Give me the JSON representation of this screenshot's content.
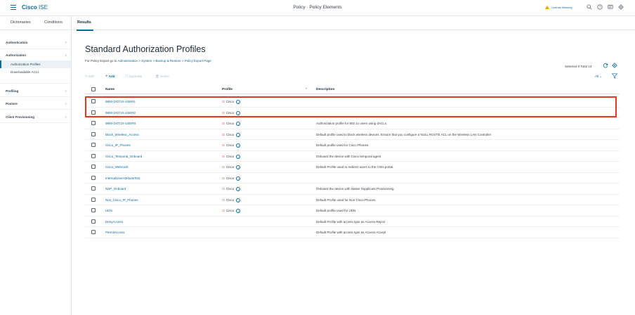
{
  "header": {
    "brand_cisco": "Cisco",
    "brand_ise": "ISE",
    "title": "Policy · Policy Elements",
    "license_warning": "License Warning",
    "icons": [
      "search-icon",
      "help-icon",
      "notifications-icon",
      "gear-icon"
    ]
  },
  "tabs": [
    {
      "label": "Dictionaries"
    },
    {
      "label": "Conditions"
    },
    {
      "label": "Results"
    }
  ],
  "sidebar": {
    "items": [
      {
        "label": "Authentication",
        "chevron": ">"
      },
      {
        "label": "Authorization",
        "chevron": "v"
      },
      {
        "label": "Profiling",
        "chevron": ">"
      },
      {
        "label": "Posture",
        "chevron": ">"
      },
      {
        "label": "Client Provisioning",
        "chevron": ">"
      }
    ],
    "subitems": [
      {
        "label": "Authorization Profiles"
      },
      {
        "label": "Downloadable ACLs"
      }
    ]
  },
  "main": {
    "title": "Standard Authorization Profiles",
    "export_prefix": "For Policy Export go to",
    "export_link": "Administration > System > Backup & Restore > Policy Export Page",
    "selected_total": "Selected 0  Total 13",
    "toolbar": {
      "edit": "Edit",
      "add": "Add",
      "duplicate": "Duplicate",
      "delete": "Delete"
    },
    "filter_select": "All",
    "columns": {
      "name": "Name",
      "profile": "Profile",
      "sort": "^",
      "description": "Description"
    },
    "rows": [
      {
        "name": "9800-DOT1X-USER1",
        "profile": "Cisco",
        "description": ""
      },
      {
        "name": "9800-DOT1X-USER2",
        "profile": "Cisco",
        "description": ""
      },
      {
        "name": "9800-DOT1X-USERS",
        "profile": "Cisco",
        "description": "Authorization profile for 802.1x users using dACLs."
      },
      {
        "name": "Block_Wireless_Access",
        "profile": "Cisco",
        "description": "Default profile used to block wireless devices. Ensure that you configure a NULL ROUTE ACL on the Wireless LAN Controller"
      },
      {
        "name": "Cisco_IP_Phones",
        "profile": "Cisco",
        "description": "Default profile used for Cisco Phones."
      },
      {
        "name": "Cisco_Temporal_Onboard",
        "profile": "Cisco",
        "description": "Onboard the device with Cisco temporal agent"
      },
      {
        "name": "Cisco_WebAuth",
        "profile": "Cisco",
        "description": "Default Profile used to redirect users to the CWA portal."
      },
      {
        "name": "InternalUserAttributeTest",
        "profile": "Cisco",
        "description": ""
      },
      {
        "name": "NSP_Onboard",
        "profile": "Cisco",
        "description": "Onboard the device with Native Supplicant Provisioning"
      },
      {
        "name": "Non_Cisco_IP_Phones",
        "profile": "Cisco",
        "description": "Default Profile used for Non Cisco Phones."
      },
      {
        "name": "UDN",
        "profile": "Cisco",
        "description": "Default profile used for UDN."
      },
      {
        "name": "DenyAccess",
        "profile": "",
        "description": "Default Profile with access type as Access-Reject"
      },
      {
        "name": "PermitAccess",
        "profile": "",
        "description": "Default Profile with access type as Access-Accept"
      }
    ]
  },
  "colors": {
    "accent": "#0d6b9e",
    "highlight": "#e23b22",
    "warning": "#f0a400"
  }
}
